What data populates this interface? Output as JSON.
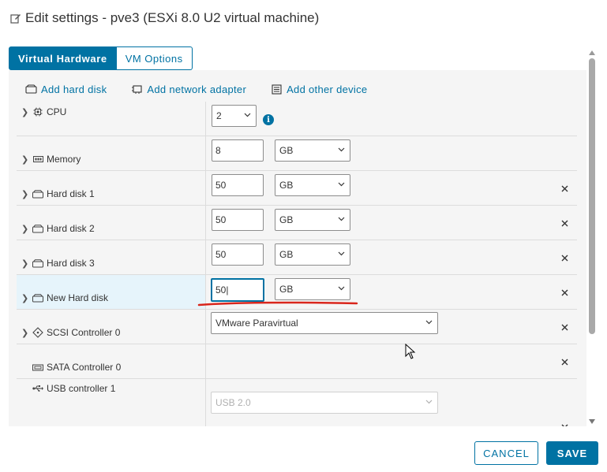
{
  "dialog": {
    "title": "Edit settings - pve3 (ESXi 8.0 U2 virtual machine)"
  },
  "tabs": [
    {
      "label": "Virtual Hardware",
      "active": true
    },
    {
      "label": "VM Options",
      "active": false
    }
  ],
  "actions": {
    "add_hard_disk": "Add hard disk",
    "add_network_adapter": "Add network adapter",
    "add_other_device": "Add other device"
  },
  "rows": {
    "cpu": {
      "label": "CPU",
      "value": "2",
      "info": "i"
    },
    "memory": {
      "label": "Memory",
      "value": "8",
      "unit": "GB"
    },
    "hard_disk_1": {
      "label": "Hard disk 1",
      "value": "50",
      "unit": "GB"
    },
    "hard_disk_2": {
      "label": "Hard disk 2",
      "value": "50",
      "unit": "GB"
    },
    "hard_disk_3": {
      "label": "Hard disk 3",
      "value": "50",
      "unit": "GB"
    },
    "new_hard_disk": {
      "label": "New Hard disk",
      "value": "50|",
      "unit": "GB"
    },
    "scsi": {
      "label": "SCSI Controller 0",
      "value": "VMware Paravirtual"
    },
    "sata": {
      "label": "SATA Controller 0"
    },
    "usb": {
      "label": "USB controller 1",
      "value": "USB 2.0"
    }
  },
  "footer": {
    "cancel_label": "CANCEL",
    "save_label": "SAVE"
  },
  "colors": {
    "accent": "#0072a3",
    "annotation": "#d9261c",
    "selected_row": "#e6f4fb"
  }
}
